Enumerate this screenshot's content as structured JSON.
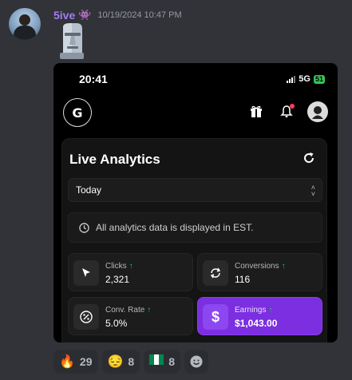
{
  "message": {
    "username": "5ive",
    "username_emoji": "👾",
    "timestamp": "10/19/2024 10:47 PM",
    "attachment_emoji": "moai-icon"
  },
  "phone": {
    "status_time": "20:41",
    "network": "5G",
    "battery": "51",
    "logo_letter": "G",
    "analytics": {
      "title": "Live Analytics",
      "date_select": "Today",
      "info_text": "All analytics data is displayed in EST.",
      "metrics": [
        {
          "label": "Clicks",
          "value": "2,321",
          "icon": "cursor-icon"
        },
        {
          "label": "Conversions",
          "value": "116",
          "icon": "refresh-icon"
        },
        {
          "label": "Conv. Rate",
          "value": "5.0%",
          "icon": "percent-icon"
        },
        {
          "label": "Earnings",
          "value": "$1,043.00",
          "icon": "dollar-icon"
        }
      ]
    }
  },
  "reactions": [
    {
      "emoji": "🔥",
      "count": "29",
      "icon": "fire-icon"
    },
    {
      "emoji": "😔",
      "count": "8",
      "icon": "pensive-face-icon"
    },
    {
      "emoji": "🇳🇬",
      "count": "8",
      "icon": "nigeria-flag-icon"
    }
  ],
  "colors": {
    "discord_bg": "#313338",
    "username": "#a47bf5",
    "accent_purple": "#7b2fe0",
    "up_green": "#22c55e"
  }
}
